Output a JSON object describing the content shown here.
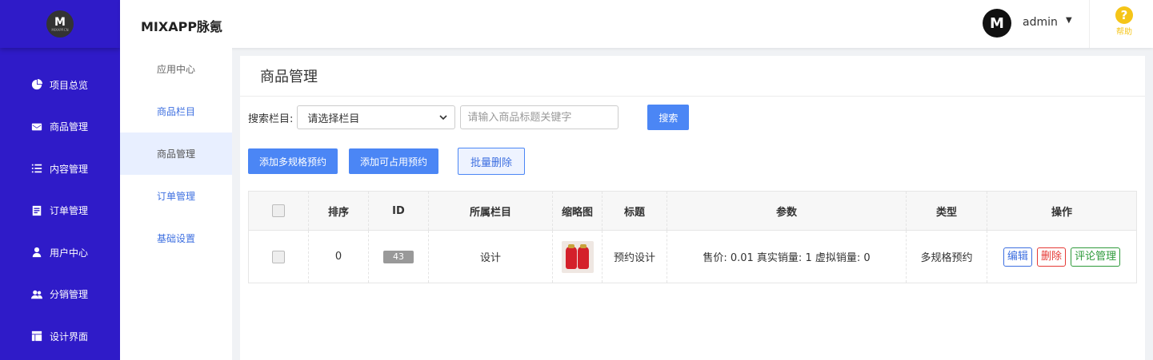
{
  "app": {
    "title": "MIXAPP脉氪",
    "logo_initial": "M",
    "logo_subtext": "MIXAPP.CN"
  },
  "user": {
    "name": "admin",
    "avatar_initial": "M"
  },
  "help": {
    "icon": "?",
    "label": "帮助"
  },
  "sidebar": {
    "items": [
      {
        "label": "项目总览",
        "icon": "pie-chart-icon"
      },
      {
        "label": "商品管理",
        "icon": "envelope-icon"
      },
      {
        "label": "内容管理",
        "icon": "list-icon"
      },
      {
        "label": "订单管理",
        "icon": "document-icon"
      },
      {
        "label": "用户中心",
        "icon": "user-icon"
      },
      {
        "label": "分销管理",
        "icon": "users-icon"
      },
      {
        "label": "设计界面",
        "icon": "layout-icon"
      }
    ]
  },
  "subnav": {
    "items": [
      {
        "label": "应用中心"
      },
      {
        "label": "商品栏目"
      },
      {
        "label": "商品管理"
      },
      {
        "label": "订单管理"
      },
      {
        "label": "基础设置"
      }
    ],
    "active_index": 2
  },
  "page": {
    "title": "商品管理"
  },
  "filter": {
    "label": "搜索栏目:",
    "select_value": "请选择栏目",
    "search_placeholder": "请输入商品标题关键字",
    "search_button": "搜索"
  },
  "actions": {
    "add_multi": "添加多规格预约",
    "add_available": "添加可占用预约",
    "batch_delete": "批量删除"
  },
  "table": {
    "headers": [
      "排序",
      "ID",
      "所属栏目",
      "缩略图",
      "标题",
      "参数",
      "类型",
      "操作"
    ],
    "rows": [
      {
        "sort": "0",
        "id": "43",
        "category": "设计",
        "title": "预约设计",
        "params": "售价: 0.01 真实销量: 1 虚拟销量: 0",
        "type": "多规格预约",
        "ops": {
          "edit": "编辑",
          "delete": "删除",
          "comments": "评论管理"
        }
      }
    ]
  },
  "colors": {
    "sidebar_bg": "#2f1bc8",
    "primary": "#4b86f5",
    "help": "#f5c518",
    "delete": "#e53935",
    "comment": "#2e9a3a"
  }
}
